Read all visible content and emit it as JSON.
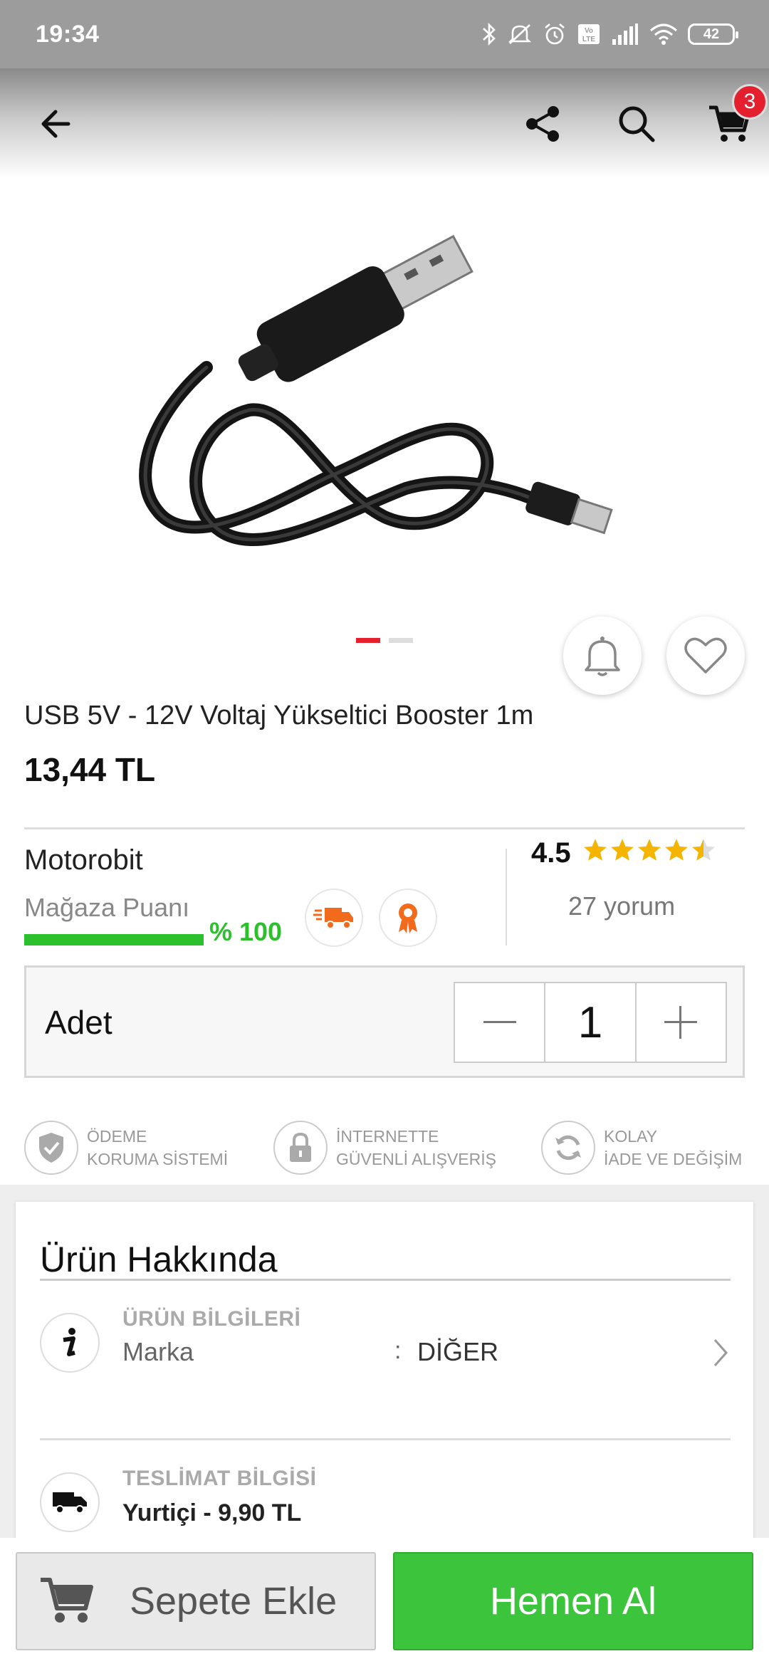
{
  "status_bar": {
    "time": "19:34",
    "battery": "42",
    "icons": [
      "bluetooth-icon",
      "mute-icon",
      "alarm-icon",
      "volte-icon",
      "signal-icon",
      "wifi-icon"
    ]
  },
  "header": {
    "cart_count": "3",
    "icons": [
      "back-arrow-icon",
      "share-icon",
      "search-icon",
      "cart-icon"
    ]
  },
  "gallery": {
    "image_count": 2,
    "active_index": 0
  },
  "product": {
    "title": "USB 5V - 12V Voltaj Yükseltici Booster 1m",
    "price": "13,44 TL"
  },
  "seller": {
    "name": "Motorobit",
    "score_label": "Mağaza Puanı",
    "score_value": "% 100",
    "score_fraction": 1.0,
    "rating": "4.5",
    "rating_value": 4.5,
    "rating_max": 5,
    "reviews": "27 yorum"
  },
  "quantity": {
    "label": "Adet",
    "value": "1"
  },
  "assurances": [
    {
      "line1": "ÖDEME",
      "line2": "KORUMA SİSTEMİ",
      "icon": "shield-check-icon"
    },
    {
      "line1": "İNTERNETTE",
      "line2": "GÜVENLİ ALIŞVERİŞ",
      "icon": "lock-icon"
    },
    {
      "line1": "KOLAY",
      "line2": "İADE VE DEĞİŞİM",
      "icon": "refresh-icon"
    }
  ],
  "about": {
    "title": "Ürün Hakkında",
    "product_info": {
      "heading": "ÜRÜN BİLGİLERİ",
      "key": "Marka",
      "colon": ":",
      "value": "DİĞER"
    },
    "delivery": {
      "heading": "TESLİMAT BİLGİSİ",
      "value": "Yurtiçi - 9,90 TL"
    }
  },
  "actions": {
    "add_to_cart": "Sepete Ekle",
    "buy_now": "Hemen Al"
  },
  "colors": {
    "accent_red": "#e5202e",
    "accent_green": "#3cc43c",
    "orange_badge": "#f26b1d"
  }
}
